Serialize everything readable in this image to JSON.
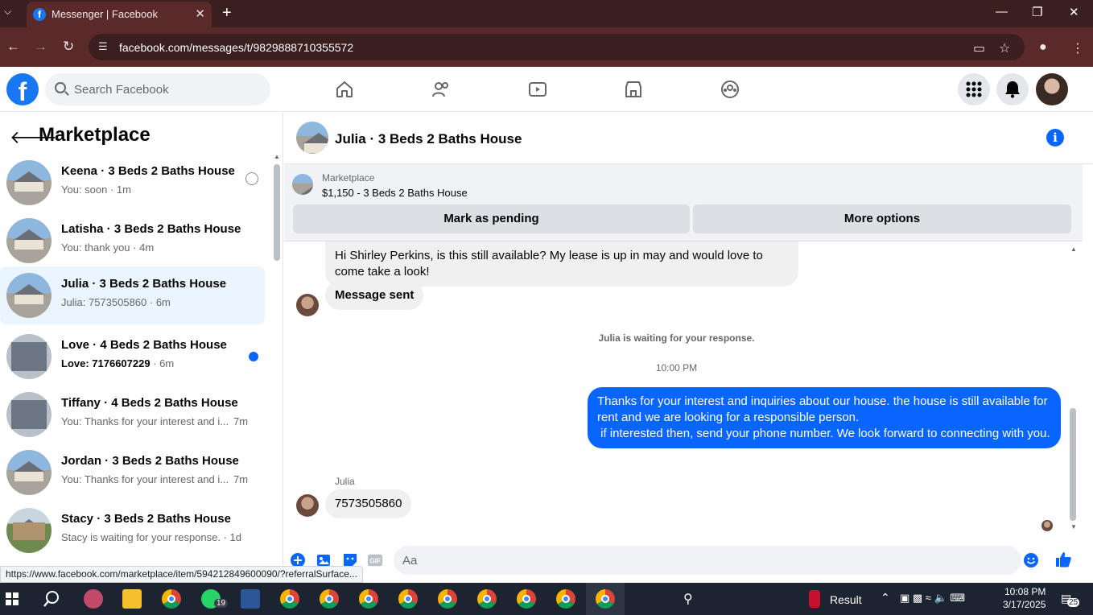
{
  "browser": {
    "tab_title": "Messenger | Facebook",
    "url": "facebook.com/messages/t/9829888710355572"
  },
  "fb": {
    "search_placeholder": "Search Facebook"
  },
  "sidebar": {
    "title": "Marketplace",
    "conversations": [
      {
        "name": "Keena · 3 Beds 2 Baths House",
        "preview": "You: soon · 1m",
        "time": "",
        "status": "read-ring"
      },
      {
        "name": "Latisha · 3 Beds 2 Baths House",
        "preview": "You: thank you · 4m",
        "time": "",
        "status": ""
      },
      {
        "name": "Julia · 3 Beds 2 Baths House",
        "preview": "Julia: 7573505860 · 6m",
        "time": "",
        "status": "active"
      },
      {
        "name": "Love · 4 Beds 2 Baths House",
        "preview": "Love: 7176607229",
        "time": " · 6m",
        "status": "unread"
      },
      {
        "name": "Tiffany · 4 Beds 2 Baths House",
        "preview": "You: Thanks for your interest and i...",
        "time": "7m",
        "status": ""
      },
      {
        "name": "Jordan · 3 Beds 2 Baths House",
        "preview": "You: Thanks for your interest and i...",
        "time": "7m",
        "status": ""
      },
      {
        "name": "Stacy · 3 Beds 2 Baths House",
        "preview": "Stacy is waiting for your response. · 1d",
        "time": "",
        "status": ""
      }
    ]
  },
  "chat": {
    "title": "Julia · 3 Beds 2 Baths House",
    "marketplace_label": "Marketplace",
    "listing": "$1,150 - 3 Beds 2 Baths House",
    "mark_pending": "Mark as pending",
    "more_options": "More options",
    "msg_inquiry": "Hi Shirley Perkins, is this still available? My lease is up in may and would love to come take a look!",
    "msg_sent": "Message sent",
    "waiting_text": "Julia is waiting for your response.",
    "timestamp": "10:00 PM",
    "msg_reply": "Thanks for your interest and inquiries about our house. the house is still available for rent and we are looking for a responsible person.\n if interested then, send your phone number. We look forward to connecting with you.",
    "sender_name": "Julia",
    "msg_phone": "7573505860",
    "composer_placeholder": "Aa"
  },
  "status_url": "https://www.facebook.com/marketplace/item/594212849600090/?referralSurface...",
  "taskbar": {
    "whatsapp_badge": "19",
    "weather_label": "Result",
    "time": "10:08 PM",
    "date": "3/17/2025",
    "notif_count": "25"
  },
  "colors": {
    "fb_blue": "#1877f2",
    "messenger_blue": "#0866ff",
    "chrome_dark": "#3b1f1f",
    "chrome_mid": "#5a2a2a"
  }
}
